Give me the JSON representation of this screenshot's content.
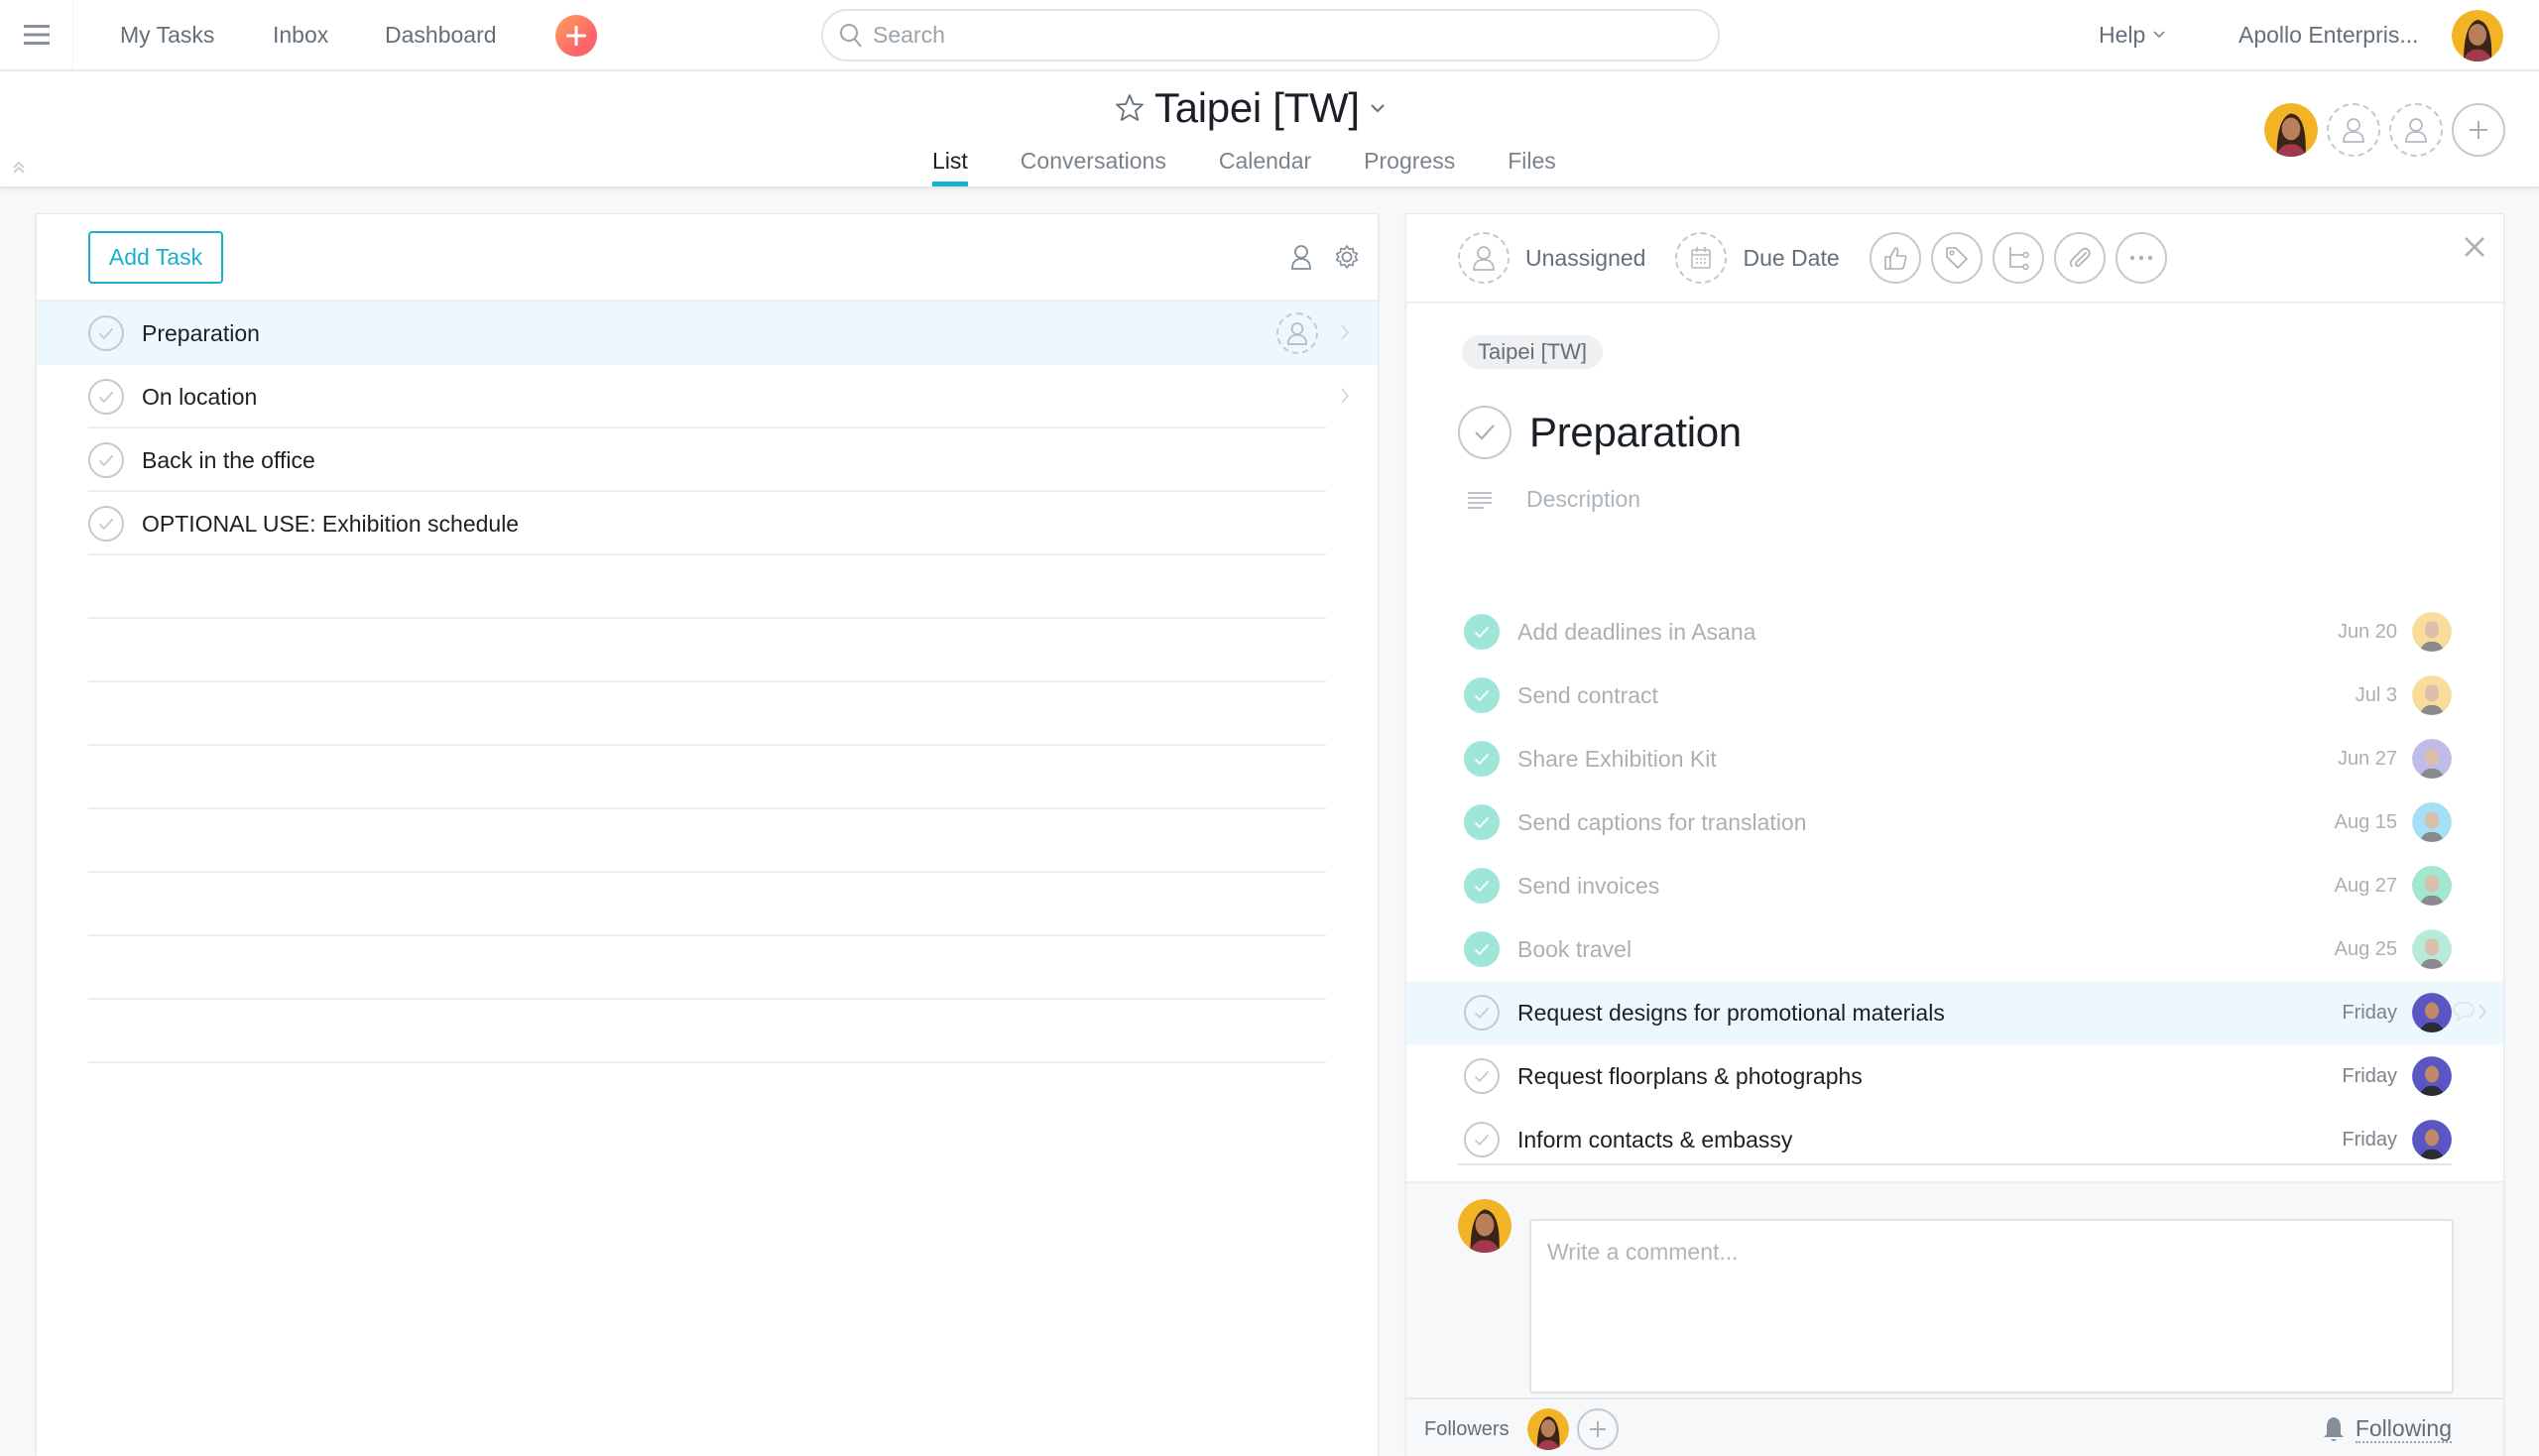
{
  "topbar": {
    "menu_icon": "hamburger-icon",
    "nav": [
      "My Tasks",
      "Inbox",
      "Dashboard"
    ],
    "quick_add_icon": "plus-icon",
    "search_placeholder": "Search",
    "search_value": "",
    "help_label": "Help",
    "org_label": "Apollo Enterpris...",
    "colors": {
      "accent": "#1aafd0",
      "quick_add_from": "#fca15a",
      "quick_add_to": "#fc636b"
    }
  },
  "project": {
    "title": "Taipei [TW]",
    "tabs": [
      {
        "label": "List",
        "active": true
      },
      {
        "label": "Conversations",
        "active": false
      },
      {
        "label": "Calendar",
        "active": false
      },
      {
        "label": "Progress",
        "active": false
      },
      {
        "label": "Files",
        "active": false
      }
    ]
  },
  "task_list": {
    "add_task_label": "Add Task",
    "tasks": [
      {
        "name": "Preparation",
        "selected": true
      },
      {
        "name": "On location",
        "selected": false
      },
      {
        "name": "Back in the office",
        "selected": false
      },
      {
        "name": "OPTIONAL USE: Exhibition schedule",
        "selected": false
      }
    ],
    "empty_rows": 8
  },
  "detail": {
    "assignee_label": "Unassigned",
    "due_date_label": "Due Date",
    "project_pill": "Taipei [TW]",
    "title": "Preparation",
    "description_placeholder": "Description",
    "subtasks": [
      {
        "name": "Add deadlines in Asana",
        "due": "Jun 20",
        "done": true,
        "avatar_color": "#f5c04a"
      },
      {
        "name": "Send contract",
        "due": "Jul 3",
        "done": true,
        "avatar_color": "#f5c04a"
      },
      {
        "name": "Share Exhibition Kit",
        "due": "Jun 27",
        "done": true,
        "avatar_color": "#8d86d9"
      },
      {
        "name": "Send captions for translation",
        "due": "Aug 15",
        "done": true,
        "avatar_color": "#5cc8f0"
      },
      {
        "name": "Send invoices",
        "due": "Aug 27",
        "done": true,
        "avatar_color": "#55d6a9"
      },
      {
        "name": "Book travel",
        "due": "Aug 25",
        "done": true,
        "avatar_color": "#7fdcb8"
      },
      {
        "name": "Request designs for promotional materials",
        "due": "Friday",
        "done": false,
        "avatar_color": "#5a56c4",
        "selected": true
      },
      {
        "name": "Request floorplans & photographs",
        "due": "Friday",
        "done": false,
        "avatar_color": "#5a56c4"
      },
      {
        "name": "Inform contacts & embassy",
        "due": "Friday",
        "done": false,
        "avatar_color": "#5a56c4"
      }
    ],
    "comment_placeholder": "Write a comment...",
    "followers_label": "Followers",
    "following_label": "Following"
  }
}
